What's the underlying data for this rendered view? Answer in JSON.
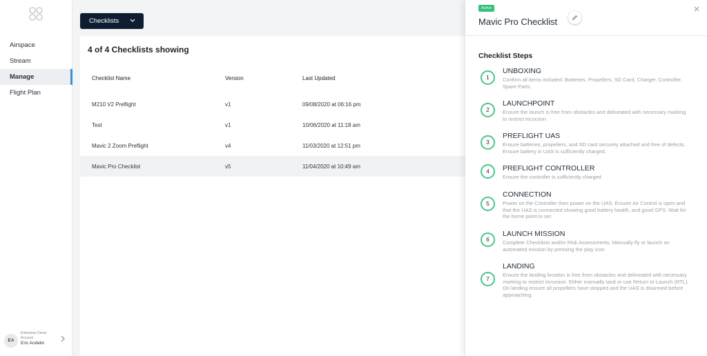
{
  "sidebar": {
    "logo_icon": "clover-logo-icon",
    "items": [
      {
        "label": "Airspace"
      },
      {
        "label": "Stream"
      },
      {
        "label": "Manage"
      },
      {
        "label": "Flight Plan"
      }
    ],
    "account": {
      "initials": "EA",
      "line1": "Enterprise Demo",
      "line2": "Account",
      "name": "Eric Andelin"
    }
  },
  "main": {
    "dropdown_label": "Checklists",
    "count_title": "4 of 4 Checklists showing",
    "columns": {
      "name": "Checklist Name",
      "version": "Version",
      "updated": "Last Updated"
    },
    "rows": [
      {
        "name": "M210 V2 Preflight",
        "version": "v1",
        "updated": "09/08/2020 at 06:16 pm"
      },
      {
        "name": "Test",
        "version": "v1",
        "updated": "10/06/2020 at 11:18 am"
      },
      {
        "name": "Mavic 2 Zoom Preflight",
        "version": "v4",
        "updated": "11/03/2020 at 12:51 pm"
      },
      {
        "name": "Mavic Pro Checklist",
        "version": "v5",
        "updated": "11/04/2020 at 10:49 am"
      }
    ]
  },
  "drawer": {
    "badge": "Active",
    "title": "Mavic Pro Checklist",
    "steps_heading": "Checklist Steps",
    "accent_color": "#4cc38a",
    "steps": [
      {
        "num": "1",
        "title": "UNBOXING",
        "desc": "Confirm all items included: Batteries, Propellers, SD Card, Charger, Controller, Spare Parts."
      },
      {
        "num": "2",
        "title": "LAUNCHPOINT",
        "desc": "Ensure the launch is free from obstacles and delineated with necessary marking to restrict incursion"
      },
      {
        "num": "3",
        "title": "PREFLIGHT UAS",
        "desc": "Ensure batteries, propellers, and SD card securely attached and free of defects. Ensure battery in UAS is sufficiently charged."
      },
      {
        "num": "4",
        "title": "PREFLIGHT CONTROLLER",
        "desc": "Ensure the controller is sufficiently charged"
      },
      {
        "num": "5",
        "title": "CONNECTION",
        "desc": "Power on the Controller then power on the UAS. Ensure Air Control is open and that the UAS is connected showing good battery health, and good GPS. Wait for the home point to set"
      },
      {
        "num": "6",
        "title": "LAUNCH MISSION",
        "desc": "Complete Checklists and/or Risk Assessments. Manually fly or launch an automated mission by pressing the play icon"
      },
      {
        "num": "7",
        "title": "LANDING",
        "desc": "Ensure the landing location is free from obstacles and delineated with necessary marking to restrict incursion. Either manually land or use Return to Launch (RTL). On landing ensure all propellers have stopped and the UAS is disarmed before approaching."
      }
    ]
  }
}
